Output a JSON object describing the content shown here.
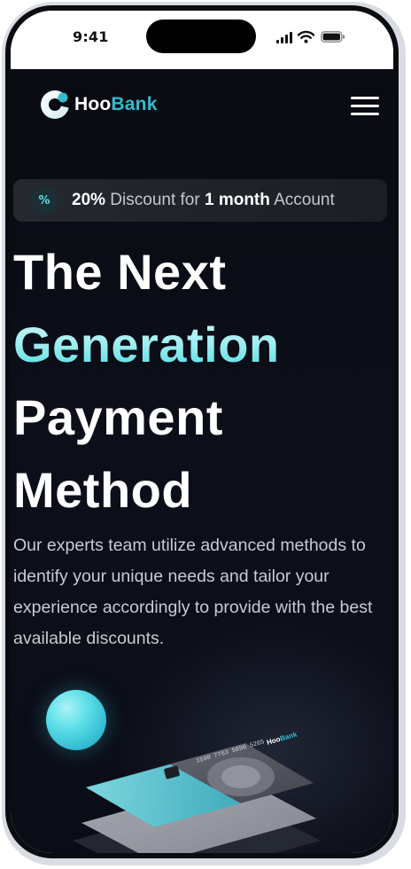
{
  "status_bar": {
    "time": "9:41"
  },
  "navbar": {
    "brand_prefix": "Hoo",
    "brand_suffix": "Bank"
  },
  "promo": {
    "percent": "20%",
    "text_1": " Discount for ",
    "duration": "1 month",
    "text_2": " Account"
  },
  "hero": {
    "title_line_1": "The Next",
    "title_line_2": "Generation",
    "title_line_3": "Payment",
    "title_line_4": "Method",
    "description": "Our experts team utilize advanced methods to identify your unique needs and tailor your experience accordingly to provide with the best available discounts."
  },
  "card": {
    "number": "1598 7763 5690 5265",
    "brand_prefix": "Hoo",
    "brand_suffix": "Bank"
  },
  "colors": {
    "accent": "#33bbcf",
    "accent_light": "#5ce1e6",
    "background": "#0a0b12",
    "promo_bg": "#262830",
    "text_dim": "#c9cbd2"
  },
  "icons": [
    "signal-icon",
    "wifi-icon",
    "battery-icon",
    "logo-icon",
    "menu-icon",
    "discount-icon"
  ]
}
